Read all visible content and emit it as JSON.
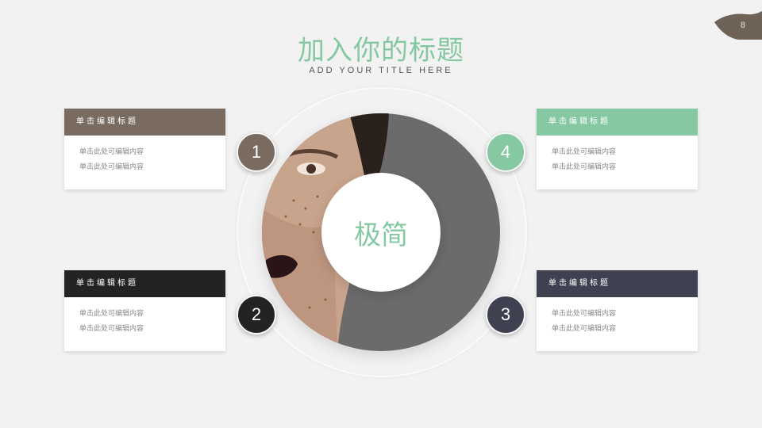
{
  "slide": {
    "page_number": "8",
    "title": "加入你的标题",
    "subtitle": "ADD YOUR TITLE HERE",
    "center_text": "极简"
  },
  "colors": {
    "accent_green": "#86c8a2",
    "brown": "#7a6b60",
    "black": "#232323",
    "slate": "#3f4150",
    "photo_gray": "#6c6b6c"
  },
  "cards": [
    {
      "number": "1",
      "header": "单击编辑标题",
      "lines": [
        "单击此处可编辑内容",
        "单击此处可编辑内容"
      ],
      "color": "#7a6b60"
    },
    {
      "number": "2",
      "header": "单击编辑标题",
      "lines": [
        "单击此处可编辑内容",
        "单击此处可编辑内容"
      ],
      "color": "#232323"
    },
    {
      "number": "3",
      "header": "单击编辑标题",
      "lines": [
        "单击此处可编辑内容",
        "单击此处可编辑内容"
      ],
      "color": "#3f4150"
    },
    {
      "number": "4",
      "header": "单击编辑标题",
      "lines": [
        "单击此处可编辑内容",
        "单击此处可编辑内容"
      ],
      "color": "#86c8a2"
    }
  ]
}
